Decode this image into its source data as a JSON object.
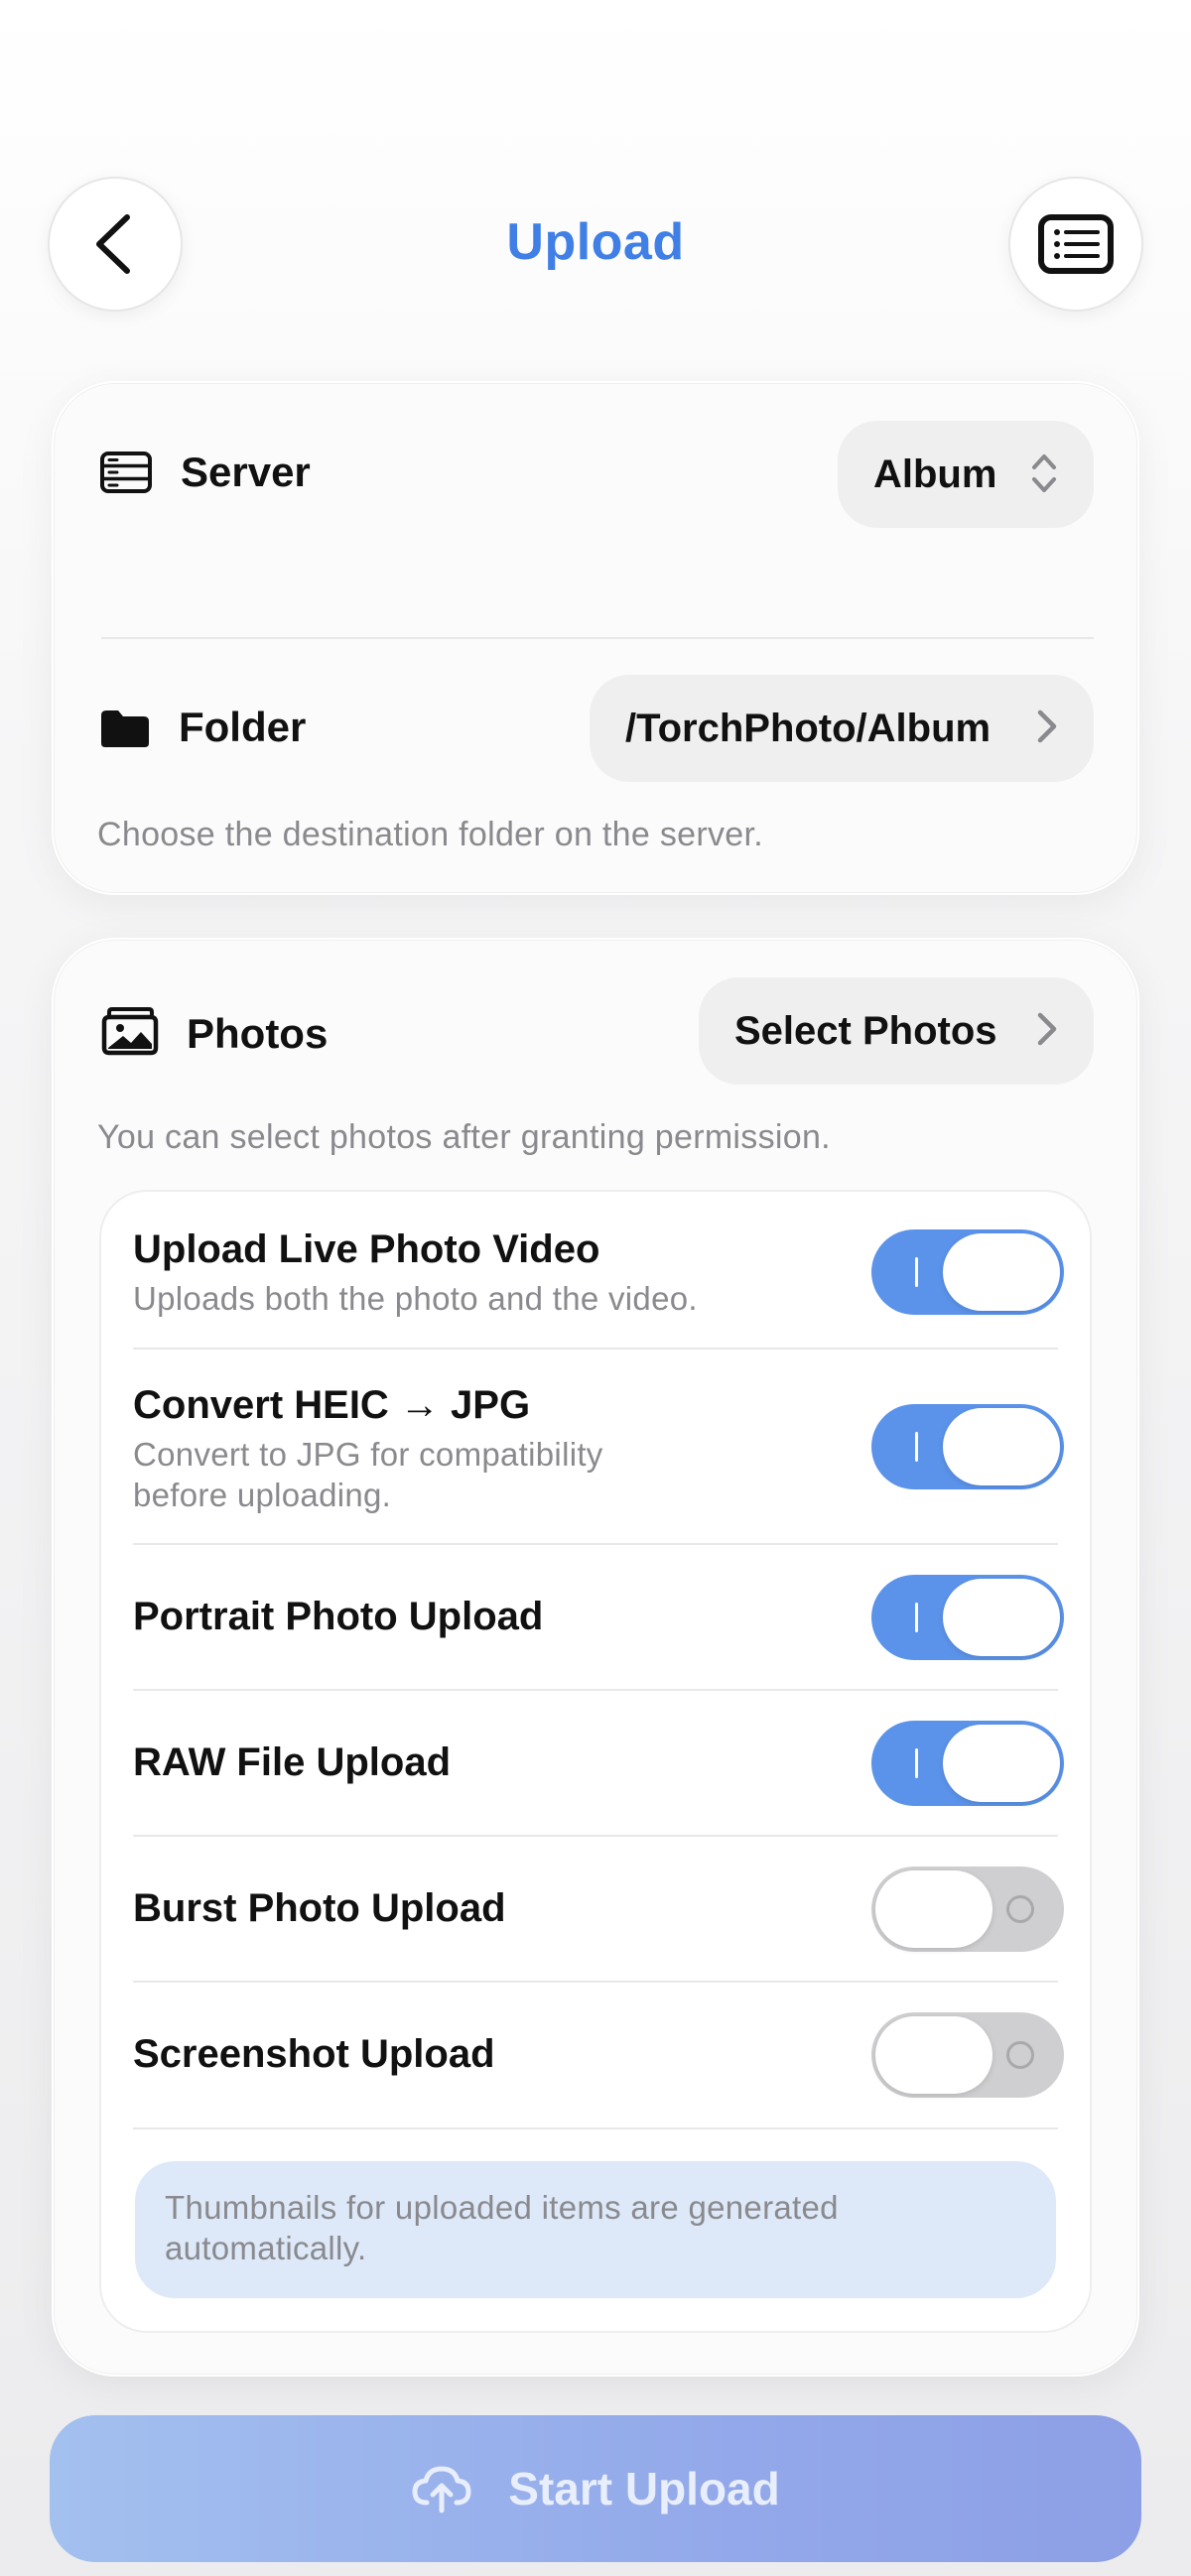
{
  "header": {
    "title": "Upload",
    "back_icon": "chevron-left-icon",
    "list_icon": "list-icon"
  },
  "server_card": {
    "server_label": "Server",
    "server_value": "Album",
    "folder_label": "Folder",
    "folder_value": "/TorchPhoto/Album",
    "folder_hint": "Choose the destination folder on the server."
  },
  "photos_card": {
    "photos_label": "Photos",
    "select_button": "Select Photos",
    "permission_hint": "You can select photos after granting permission.",
    "options": [
      {
        "title": "Upload Live Photo Video",
        "subtitle": "Uploads both the photo and the video.",
        "on": true
      },
      {
        "title": "Convert HEIC → JPG",
        "subtitle": "Convert to JPG for compatibility before uploading.",
        "on": true
      },
      {
        "title": "Portrait Photo Upload",
        "subtitle": "",
        "on": true
      },
      {
        "title": "RAW File Upload",
        "subtitle": "",
        "on": true
      },
      {
        "title": "Burst Photo Upload",
        "subtitle": "",
        "on": false
      },
      {
        "title": "Screenshot Upload",
        "subtitle": "",
        "on": false
      }
    ],
    "note": "Thumbnails for uploaded items are generated automatically."
  },
  "footer": {
    "start_button": "Start Upload",
    "upload_icon": "cloud-upload-icon"
  },
  "colors": {
    "accent": "#3f7fe6",
    "toggle_on": "#5b93ea",
    "toggle_off": "#cfcfd1",
    "note_bg": "#dde9f8"
  }
}
